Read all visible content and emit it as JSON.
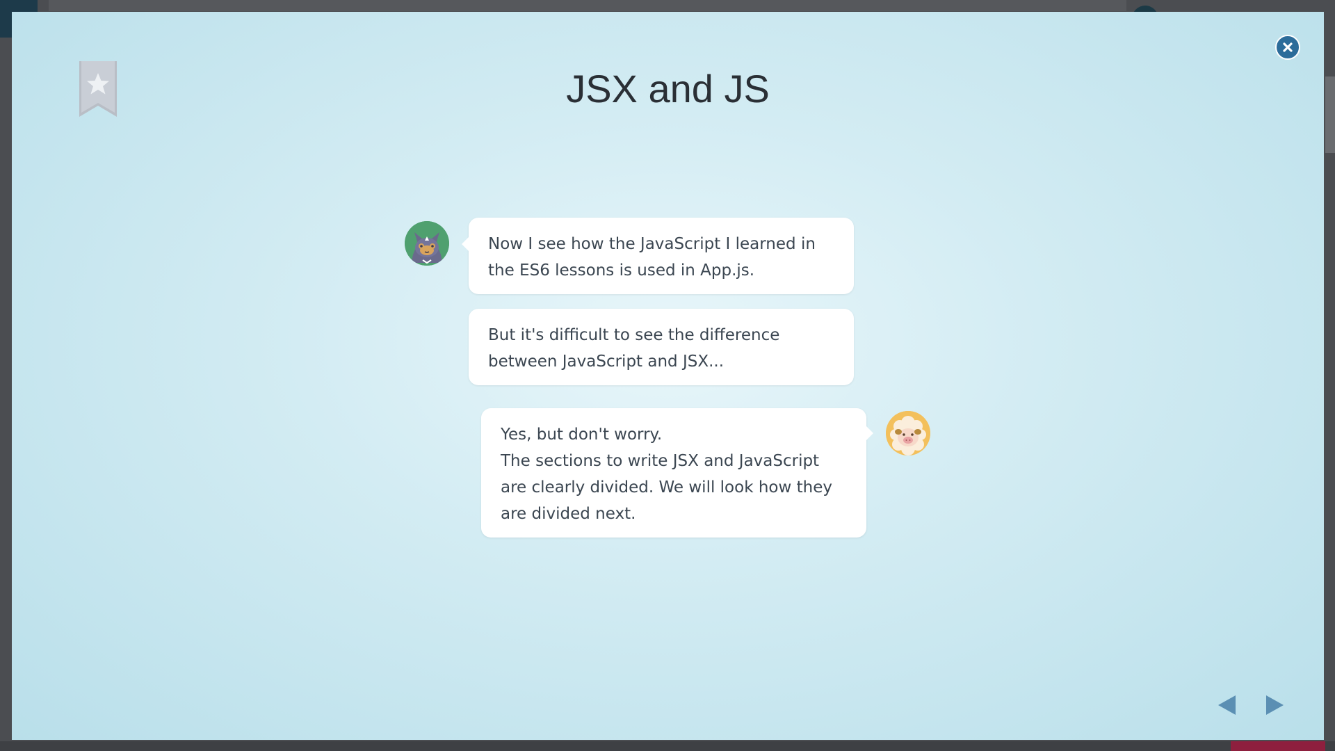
{
  "lesson": {
    "title": "JSX and JS"
  },
  "conversation": [
    {
      "speaker": "cat",
      "text": "Now I see how the JavaScript I learned in the ES6 lessons is used in App.js."
    },
    {
      "speaker": "cat",
      "text": "But it's difficult to see the difference between JavaScript and JSX..."
    },
    {
      "speaker": "sheep",
      "line1": "Yes, but don't worry.",
      "line2": "The sections to write JSX and JavaScript are clearly divided. We will look how they are divided next."
    }
  ],
  "icons": {
    "close": "close-icon",
    "bookmark": "bookmark-star-icon",
    "prev": "triangle-left-icon",
    "next": "triangle-right-icon"
  },
  "colors": {
    "accent": "#2c6c9a",
    "nav_arrow": "#5b8fb3",
    "title": "#2a2f35",
    "bubble_text": "#3b4651",
    "cat_avatar_bg": "#4fa06f",
    "sheep_avatar_bg": "#f3c05c"
  }
}
